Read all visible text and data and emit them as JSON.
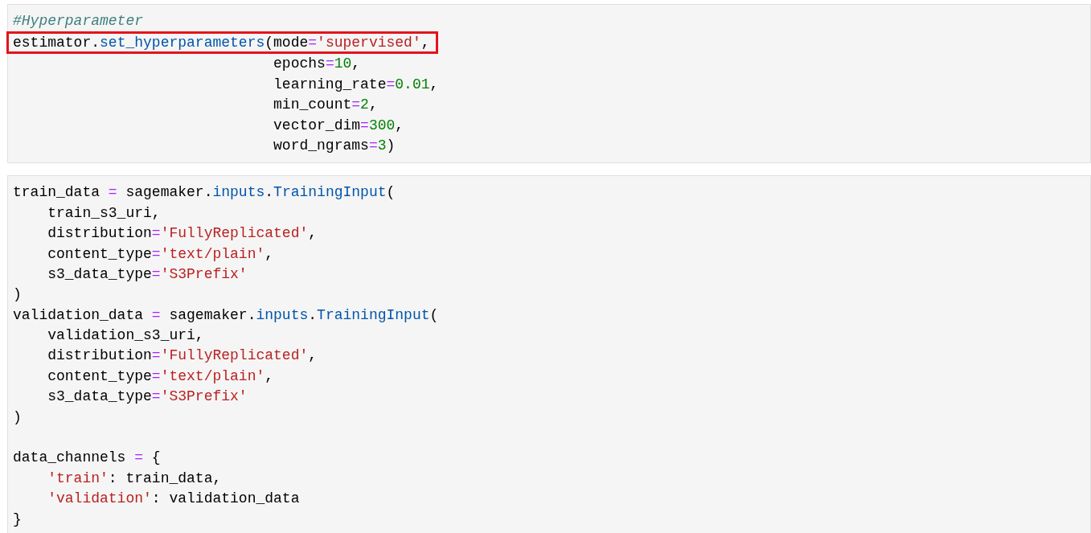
{
  "cells": [
    {
      "lines": [
        {
          "highlighted": false,
          "tokens": [
            {
              "kind": "comment",
              "t": "#Hyperparameter"
            }
          ]
        },
        {
          "highlighted": true,
          "tokens": [
            {
              "kind": "plain",
              "t": "estimator."
            },
            {
              "kind": "name",
              "t": "set_hyperparameters"
            },
            {
              "kind": "plain",
              "t": "(mode"
            },
            {
              "kind": "operator",
              "t": "="
            },
            {
              "kind": "string",
              "t": "'supervised'"
            },
            {
              "kind": "plain",
              "t": ","
            }
          ]
        },
        {
          "highlighted": false,
          "tokens": [
            {
              "kind": "plain",
              "t": "                              epochs"
            },
            {
              "kind": "operator",
              "t": "="
            },
            {
              "kind": "number",
              "t": "10"
            },
            {
              "kind": "plain",
              "t": ","
            }
          ]
        },
        {
          "highlighted": false,
          "tokens": [
            {
              "kind": "plain",
              "t": "                              learning_rate"
            },
            {
              "kind": "operator",
              "t": "="
            },
            {
              "kind": "number",
              "t": "0.01"
            },
            {
              "kind": "plain",
              "t": ","
            }
          ]
        },
        {
          "highlighted": false,
          "tokens": [
            {
              "kind": "plain",
              "t": "                              min_count"
            },
            {
              "kind": "operator",
              "t": "="
            },
            {
              "kind": "number",
              "t": "2"
            },
            {
              "kind": "plain",
              "t": ","
            }
          ]
        },
        {
          "highlighted": false,
          "tokens": [
            {
              "kind": "plain",
              "t": "                              vector_dim"
            },
            {
              "kind": "operator",
              "t": "="
            },
            {
              "kind": "number",
              "t": "300"
            },
            {
              "kind": "plain",
              "t": ","
            }
          ]
        },
        {
          "highlighted": false,
          "tokens": [
            {
              "kind": "plain",
              "t": "                              word_ngrams"
            },
            {
              "kind": "operator",
              "t": "="
            },
            {
              "kind": "number",
              "t": "3"
            },
            {
              "kind": "plain",
              "t": ")"
            }
          ]
        }
      ]
    },
    {
      "lines": [
        {
          "highlighted": false,
          "tokens": [
            {
              "kind": "plain",
              "t": "train_data "
            },
            {
              "kind": "operator",
              "t": "="
            },
            {
              "kind": "plain",
              "t": " sagemaker."
            },
            {
              "kind": "name",
              "t": "inputs"
            },
            {
              "kind": "plain",
              "t": "."
            },
            {
              "kind": "name",
              "t": "TrainingInput"
            },
            {
              "kind": "plain",
              "t": "("
            }
          ]
        },
        {
          "highlighted": false,
          "tokens": [
            {
              "kind": "plain",
              "t": "    train_s3_uri,"
            }
          ]
        },
        {
          "highlighted": false,
          "tokens": [
            {
              "kind": "plain",
              "t": "    distribution"
            },
            {
              "kind": "operator",
              "t": "="
            },
            {
              "kind": "string",
              "t": "'FullyReplicated'"
            },
            {
              "kind": "plain",
              "t": ","
            }
          ]
        },
        {
          "highlighted": false,
          "tokens": [
            {
              "kind": "plain",
              "t": "    content_type"
            },
            {
              "kind": "operator",
              "t": "="
            },
            {
              "kind": "string",
              "t": "'text/plain'"
            },
            {
              "kind": "plain",
              "t": ","
            }
          ]
        },
        {
          "highlighted": false,
          "tokens": [
            {
              "kind": "plain",
              "t": "    s3_data_type"
            },
            {
              "kind": "operator",
              "t": "="
            },
            {
              "kind": "string",
              "t": "'S3Prefix'"
            }
          ]
        },
        {
          "highlighted": false,
          "tokens": [
            {
              "kind": "plain",
              "t": ")"
            }
          ]
        },
        {
          "highlighted": false,
          "tokens": [
            {
              "kind": "plain",
              "t": "validation_data "
            },
            {
              "kind": "operator",
              "t": "="
            },
            {
              "kind": "plain",
              "t": " sagemaker."
            },
            {
              "kind": "name",
              "t": "inputs"
            },
            {
              "kind": "plain",
              "t": "."
            },
            {
              "kind": "name",
              "t": "TrainingInput"
            },
            {
              "kind": "plain",
              "t": "("
            }
          ]
        },
        {
          "highlighted": false,
          "tokens": [
            {
              "kind": "plain",
              "t": "    validation_s3_uri,"
            }
          ]
        },
        {
          "highlighted": false,
          "tokens": [
            {
              "kind": "plain",
              "t": "    distribution"
            },
            {
              "kind": "operator",
              "t": "="
            },
            {
              "kind": "string",
              "t": "'FullyReplicated'"
            },
            {
              "kind": "plain",
              "t": ","
            }
          ]
        },
        {
          "highlighted": false,
          "tokens": [
            {
              "kind": "plain",
              "t": "    content_type"
            },
            {
              "kind": "operator",
              "t": "="
            },
            {
              "kind": "string",
              "t": "'text/plain'"
            },
            {
              "kind": "plain",
              "t": ","
            }
          ]
        },
        {
          "highlighted": false,
          "tokens": [
            {
              "kind": "plain",
              "t": "    s3_data_type"
            },
            {
              "kind": "operator",
              "t": "="
            },
            {
              "kind": "string",
              "t": "'S3Prefix'"
            }
          ]
        },
        {
          "highlighted": false,
          "tokens": [
            {
              "kind": "plain",
              "t": ")"
            }
          ]
        },
        {
          "highlighted": false
        },
        {
          "highlighted": false,
          "tokens": [
            {
              "kind": "plain",
              "t": "data_channels "
            },
            {
              "kind": "operator",
              "t": "="
            },
            {
              "kind": "plain",
              "t": " {"
            }
          ]
        },
        {
          "highlighted": false,
          "tokens": [
            {
              "kind": "string",
              "t": "    'train'"
            },
            {
              "kind": "plain",
              "t": ": train_data,"
            }
          ]
        },
        {
          "highlighted": false,
          "tokens": [
            {
              "kind": "string",
              "t": "    'validation'"
            },
            {
              "kind": "plain",
              "t": ": validation_data"
            }
          ]
        },
        {
          "highlighted": false,
          "tokens": [
            {
              "kind": "plain",
              "t": "}"
            }
          ]
        }
      ]
    }
  ]
}
